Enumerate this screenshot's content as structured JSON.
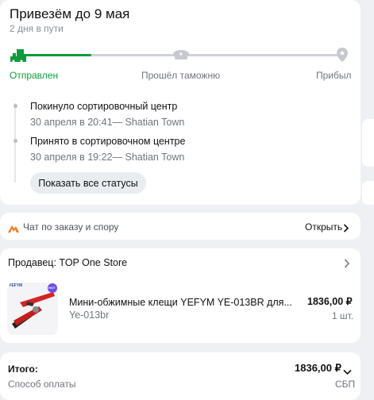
{
  "delivery": {
    "title": "Привезём до 9 мая",
    "subtitle": "2 дня в пути",
    "stages": [
      {
        "label": "Отправлен",
        "icon": "truck-icon",
        "active": true
      },
      {
        "label": "Прошёл таможню",
        "icon": "customs-cap-icon",
        "active": false
      },
      {
        "label": "Прибыл",
        "icon": "location-pin-icon",
        "active": false
      }
    ],
    "progress_fraction": 0.23,
    "events": [
      {
        "title": "Покинуло сортировочный центр",
        "meta": "30 апреля в 20:41— Shatian Town"
      },
      {
        "title": "Принято в сортировочном центре",
        "meta": "30 апреля в 19:22— Shatian Town"
      }
    ],
    "show_all_label": "Показать все статусы"
  },
  "chat": {
    "label": "Чат по заказу и спору",
    "action_label": "Открыть",
    "icon": "chat-flag-icon"
  },
  "seller": {
    "label": "Продавец: TOP One Store",
    "product": {
      "image_brand": "YEFYM",
      "image_badge": "HOT",
      "title": "Мини-обжимные клещи YEFYM YE-013BR для...",
      "sku": "Ye-013br",
      "price": "1836,00 ₽",
      "qty": "1 шт."
    }
  },
  "total": {
    "label": "Итого:",
    "amount": "1836,00 ₽",
    "payment_label": "Способ оплаты",
    "payment_value": "СБП"
  },
  "colors": {
    "accent_green": "#0f9b3c",
    "inactive_grey": "#cfd2d6",
    "chat_orange": "#f07a1f"
  }
}
